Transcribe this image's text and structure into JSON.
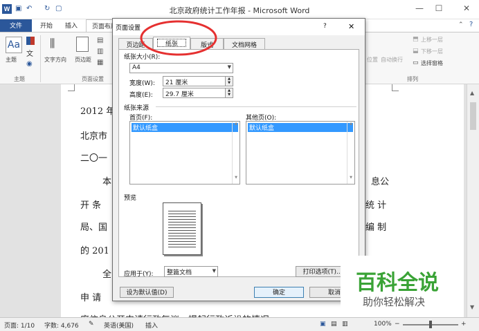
{
  "window": {
    "title": "北京政府统计工作年报 - Microsoft Word",
    "controls": [
      "—",
      "☐",
      "✕"
    ]
  },
  "ribbon_tabs": [
    "文件",
    "开始",
    "插入",
    "页面布局"
  ],
  "ribbon": {
    "theme_label": "主题",
    "orientation_label": "文字方向",
    "margins_label": "页边距",
    "page_setup_group": "页面设置",
    "theme_group": "主题",
    "arrange_group": "排列",
    "position_label": "位置",
    "wrap_label": "自动换行",
    "forward_label": "上移一层",
    "backward_label": "下移一层",
    "selection_pane_label": "选择窗格"
  },
  "document": {
    "lines": [
      "2012 年",
      "北京市",
      "二〇一",
      "本",
      "开 条",
      "局、国",
      "的 201",
      "全",
      "申 请",
      "府信息公开申请行政复议、提起行政诉讼的情况"
    ],
    "right_fragments": [
      "息公",
      "统 计",
      "编 制"
    ]
  },
  "dialog": {
    "title": "页面设置",
    "help": "?",
    "close": "✕",
    "tabs": [
      "页边距",
      "纸张",
      "版式",
      "文档网格"
    ],
    "active_tab": "纸张",
    "paper_size_label": "纸张大小(R):",
    "paper_size_value": "A4",
    "width_label": "宽度(W):",
    "width_value": "21 厘米",
    "height_label": "高度(E):",
    "height_value": "29.7 厘米",
    "source_label": "纸张来源",
    "first_page_label": "首页(F):",
    "other_pages_label": "其他页(O):",
    "first_page_item": "默认纸盒",
    "other_pages_item": "默认纸盒",
    "preview_label": "预览",
    "apply_to_label": "应用于(Y):",
    "apply_to_value": "整篇文档",
    "print_options": "打印选项(T)...",
    "set_default": "设为默认值(D)",
    "ok": "确定",
    "cancel": "取消"
  },
  "status": {
    "page": "页面: 1/10",
    "words": "字数: 4,676",
    "language": "英语(美国)",
    "mode": "插入",
    "zoom": "100%"
  },
  "watermark": {
    "title": "百科全说",
    "subtitle": "助你轻松解决"
  },
  "colors": {
    "word_blue": "#2b579a",
    "selection": "#3399ff",
    "highlight_circle": "#e53030",
    "watermark_green": "#3aa336"
  }
}
